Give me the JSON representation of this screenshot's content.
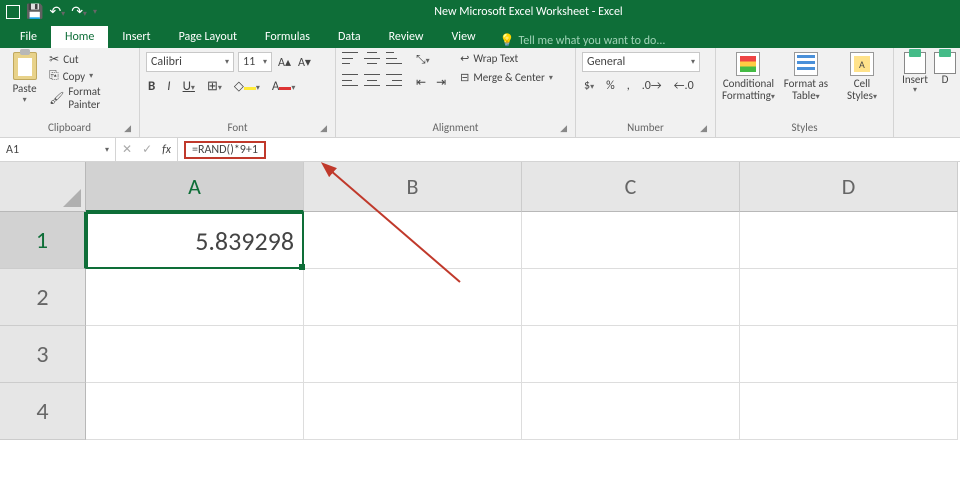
{
  "title": "New Microsoft Excel Worksheet - Excel",
  "tabs": {
    "file": "File",
    "home": "Home",
    "insert": "Insert",
    "page": "Page Layout",
    "formulas": "Formulas",
    "data": "Data",
    "review": "Review",
    "view": "View",
    "tell": "Tell me what you want to do..."
  },
  "clipboard": {
    "paste": "Paste",
    "cut": "Cut",
    "copy": "Copy",
    "painter": "Format Painter",
    "label": "Clipboard"
  },
  "font": {
    "name": "Calibri",
    "size": "11",
    "label": "Font",
    "B": "B",
    "I": "I",
    "U": "U",
    "A": "A"
  },
  "alignment": {
    "label": "Alignment",
    "wrap": "Wrap Text",
    "merge": "Merge & Center"
  },
  "number": {
    "label": "Number",
    "general": "General",
    "currency": "$",
    "percent": "%",
    "comma": ","
  },
  "styles": {
    "label": "Styles",
    "cf1": "Conditional",
    "cf2": "Formatting",
    "ft1": "Format as",
    "ft2": "Table",
    "cs1": "Cell",
    "cs2": "Styles"
  },
  "cells": {
    "insert": "Insert",
    "delete": "D"
  },
  "namebox": "A1",
  "formula": "=RAND()*9+1",
  "columns": [
    "A",
    "B",
    "C",
    "D"
  ],
  "rows": [
    "1",
    "2",
    "3",
    "4"
  ],
  "cellA1": "5.839298"
}
